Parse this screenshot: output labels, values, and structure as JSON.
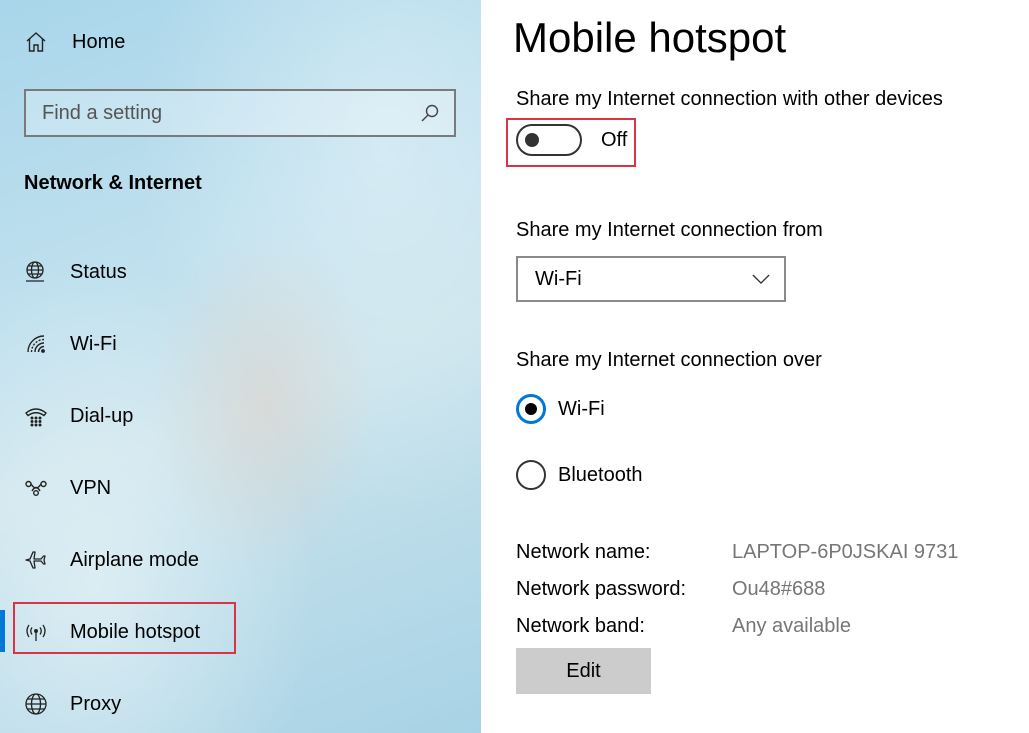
{
  "sidebar": {
    "home_label": "Home",
    "search_placeholder": "Find a setting",
    "section_title": "Network & Internet",
    "items": [
      {
        "label": "Status",
        "icon": "globe-status-icon"
      },
      {
        "label": "Wi-Fi",
        "icon": "wifi-icon"
      },
      {
        "label": "Dial-up",
        "icon": "dialup-icon"
      },
      {
        "label": "VPN",
        "icon": "vpn-icon"
      },
      {
        "label": "Airplane mode",
        "icon": "airplane-icon"
      },
      {
        "label": "Mobile hotspot",
        "icon": "hotspot-icon"
      },
      {
        "label": "Proxy",
        "icon": "globe-icon"
      }
    ],
    "selected": "Mobile hotspot"
  },
  "main": {
    "title": "Mobile hotspot",
    "share_label": "Share my Internet connection with other devices",
    "toggle_state": "Off",
    "share_from_label": "Share my Internet connection from",
    "share_from_value": "Wi-Fi",
    "share_over_label": "Share my Internet connection over",
    "share_over_options": [
      {
        "label": "Wi-Fi",
        "checked": true
      },
      {
        "label": "Bluetooth",
        "checked": false
      }
    ],
    "info": [
      {
        "label": "Network name:",
        "value": "LAPTOP-6P0JSKAI 9731"
      },
      {
        "label": "Network password:",
        "value": "Ou48#688"
      },
      {
        "label": "Network band:",
        "value": "Any available"
      }
    ],
    "edit_label": "Edit"
  },
  "colors": {
    "accent": "#0078d7",
    "highlight": "#d93445"
  }
}
